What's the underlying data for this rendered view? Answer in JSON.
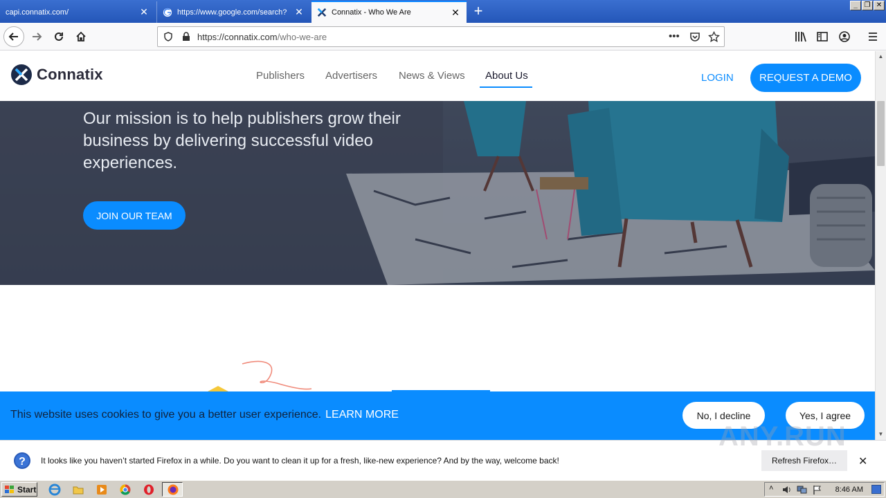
{
  "browser": {
    "tabs": [
      {
        "label": "capi.connatix.com/",
        "active": false
      },
      {
        "label": "https://www.google.com/search?",
        "active": false
      },
      {
        "label": "Connatix - Who We Are",
        "active": true
      }
    ],
    "url": {
      "host": "https://connatix.com",
      "path": "/who-we-are"
    },
    "new_tab_symbol": "+"
  },
  "site": {
    "logo_text": "Connatix",
    "menu": [
      {
        "label": "Publishers"
      },
      {
        "label": "Advertisers"
      },
      {
        "label": "News & Views"
      },
      {
        "label": "About Us"
      }
    ],
    "active_menu": "About Us",
    "login_label": "LOGIN",
    "demo_label": "REQUEST A DEMO",
    "accent": "#0a8cff"
  },
  "hero": {
    "mission": "Our mission is to help publishers grow their business by delivering successful video experiences.",
    "join_label": "JOIN OUR TEAM"
  },
  "cookie": {
    "text": "This website uses cookies to give you a better user experience.",
    "learn_more": "LEARN MORE",
    "decline_label": "No, I decline",
    "agree_label": "Yes, I agree"
  },
  "notification": {
    "text": "It looks like you haven’t started Firefox in a while. Do you want to clean it up for a fresh, like-new experience? And by the way, welcome back!",
    "refresh_label": "Refresh Firefox…"
  },
  "watermark": "ANY.RUN",
  "taskbar": {
    "start_label": "Start",
    "clock": "8:46 AM"
  }
}
